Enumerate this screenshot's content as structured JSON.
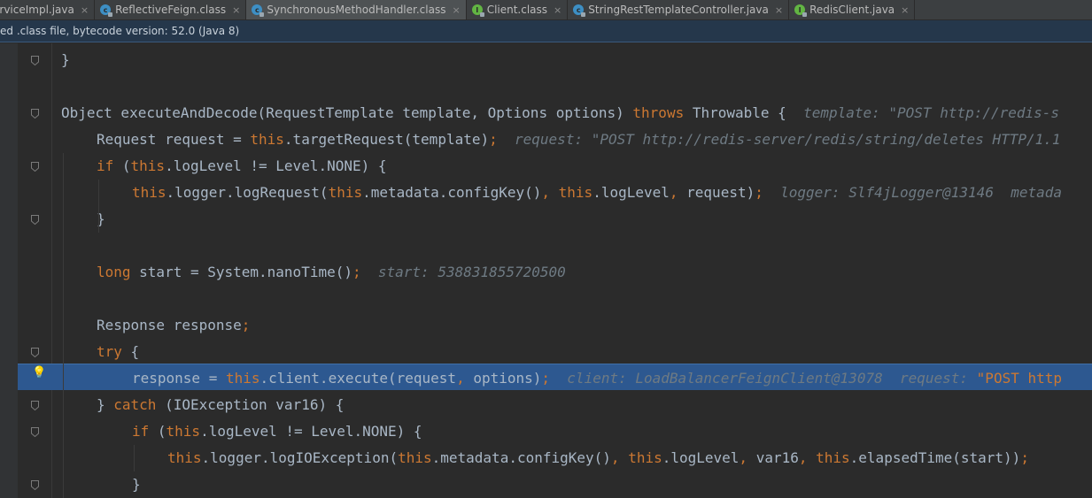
{
  "tabs": [
    {
      "label": "erviceImpl.java",
      "icon": "none",
      "close": "×",
      "active": false
    },
    {
      "label": "ReflectiveFeign.class",
      "icon": "class-icon",
      "close": "×",
      "active": false
    },
    {
      "label": "SynchronousMethodHandler.class",
      "icon": "class-icon",
      "close": "×",
      "active": true
    },
    {
      "label": "Client.class",
      "icon": "interface-icon",
      "close": "×",
      "active": false
    },
    {
      "label": "StringRestTemplateController.java",
      "icon": "class-icon",
      "close": "×",
      "active": false
    },
    {
      "label": "RedisClient.java",
      "icon": "interface-icon",
      "close": "×",
      "active": false
    }
  ],
  "banner": {
    "text": "ed .class file, bytecode version: 52.0 (Java 8)"
  },
  "colors": {
    "keyword": "#cc7832",
    "plain": "#a9b7c6",
    "hint": "#6e7a83",
    "highlight": "#2d5890",
    "background": "#2b2b2b"
  },
  "code": [
    {
      "indent": 0,
      "tokens": [
        {
          "t": "}",
          "c": "pl"
        }
      ]
    },
    {
      "indent": 0,
      "tokens": []
    },
    {
      "indent": 0,
      "tokens": [
        {
          "t": "Object executeAndDecode(RequestTemplate template, Options options) ",
          "c": "pl"
        },
        {
          "t": "throws",
          "c": "kw"
        },
        {
          "t": " Throwable {  ",
          "c": "pl"
        },
        {
          "t": "template: \"POST http://redis-s",
          "c": "hint"
        }
      ]
    },
    {
      "indent": 1,
      "tokens": [
        {
          "t": "Request request = ",
          "c": "pl"
        },
        {
          "t": "this",
          "c": "kw"
        },
        {
          "t": ".targetRequest(template)",
          "c": "pl"
        },
        {
          "t": ";",
          "c": "kw"
        },
        {
          "t": "  request: \"POST http://redis-server/redis/string/deletes HTTP/1.1",
          "c": "hint"
        }
      ]
    },
    {
      "indent": 1,
      "tokens": [
        {
          "t": "if",
          "c": "kw"
        },
        {
          "t": " (",
          "c": "pl"
        },
        {
          "t": "this",
          "c": "kw"
        },
        {
          "t": ".logLevel != Level.NONE) {",
          "c": "pl"
        }
      ]
    },
    {
      "indent": 2,
      "tokens": [
        {
          "t": "this",
          "c": "kw"
        },
        {
          "t": ".logger.logRequest(",
          "c": "pl"
        },
        {
          "t": "this",
          "c": "kw"
        },
        {
          "t": ".metadata.configKey()",
          "c": "pl"
        },
        {
          "t": ", ",
          "c": "kw"
        },
        {
          "t": "this",
          "c": "kw"
        },
        {
          "t": ".logLevel",
          "c": "pl"
        },
        {
          "t": ", ",
          "c": "kw"
        },
        {
          "t": "request)",
          "c": "pl"
        },
        {
          "t": ";",
          "c": "kw"
        },
        {
          "t": "  logger: Slf4jLogger@13146  metada",
          "c": "hint"
        }
      ]
    },
    {
      "indent": 1,
      "tokens": [
        {
          "t": "}",
          "c": "pl"
        }
      ]
    },
    {
      "indent": 0,
      "tokens": []
    },
    {
      "indent": 1,
      "tokens": [
        {
          "t": "long",
          "c": "kw"
        },
        {
          "t": " start = System.",
          "c": "pl"
        },
        {
          "t": "nanoTime",
          "c": "pl"
        },
        {
          "t": "()",
          "c": "pl"
        },
        {
          "t": ";",
          "c": "kw"
        },
        {
          "t": "  start: 538831855720500",
          "c": "hint"
        }
      ]
    },
    {
      "indent": 0,
      "tokens": []
    },
    {
      "indent": 1,
      "tokens": [
        {
          "t": "Response response",
          "c": "pl"
        },
        {
          "t": ";",
          "c": "kw"
        }
      ]
    },
    {
      "indent": 1,
      "tokens": [
        {
          "t": "try",
          "c": "kw"
        },
        {
          "t": " {",
          "c": "pl"
        }
      ]
    },
    {
      "indent": 2,
      "tokens": [
        {
          "t": "response = ",
          "c": "pl"
        },
        {
          "t": "this",
          "c": "kw"
        },
        {
          "t": ".client.execute(request",
          "c": "pl"
        },
        {
          "t": ", ",
          "c": "kw"
        },
        {
          "t": "options)",
          "c": "pl"
        },
        {
          "t": ";",
          "c": "kw"
        },
        {
          "t": "  client: LoadBalancerFeignClient@13078  request: ",
          "c": "hint"
        },
        {
          "t": "\"POST http",
          "c": "kw"
        }
      ]
    },
    {
      "indent": 1,
      "tokens": [
        {
          "t": "} ",
          "c": "pl"
        },
        {
          "t": "catch",
          "c": "kw"
        },
        {
          "t": " (IOException var16) {",
          "c": "pl"
        }
      ]
    },
    {
      "indent": 2,
      "tokens": [
        {
          "t": "if",
          "c": "kw"
        },
        {
          "t": " (",
          "c": "pl"
        },
        {
          "t": "this",
          "c": "kw"
        },
        {
          "t": ".logLevel != Level.NONE) {",
          "c": "pl"
        }
      ]
    },
    {
      "indent": 3,
      "tokens": [
        {
          "t": "this",
          "c": "kw"
        },
        {
          "t": ".logger.logIOException(",
          "c": "pl"
        },
        {
          "t": "this",
          "c": "kw"
        },
        {
          "t": ".metadata.configKey()",
          "c": "pl"
        },
        {
          "t": ", ",
          "c": "kw"
        },
        {
          "t": "this",
          "c": "kw"
        },
        {
          "t": ".logLevel",
          "c": "pl"
        },
        {
          "t": ", ",
          "c": "kw"
        },
        {
          "t": "var16",
          "c": "pl"
        },
        {
          "t": ", ",
          "c": "kw"
        },
        {
          "t": "this",
          "c": "kw"
        },
        {
          "t": ".elapsedTime(start))",
          "c": "pl"
        },
        {
          "t": ";",
          "c": "kw"
        }
      ]
    },
    {
      "indent": 2,
      "tokens": [
        {
          "t": "}",
          "c": "pl"
        }
      ]
    }
  ],
  "highlighted_line": 12,
  "fold_markers": [
    0,
    2,
    4,
    6,
    11,
    13,
    14,
    16
  ]
}
